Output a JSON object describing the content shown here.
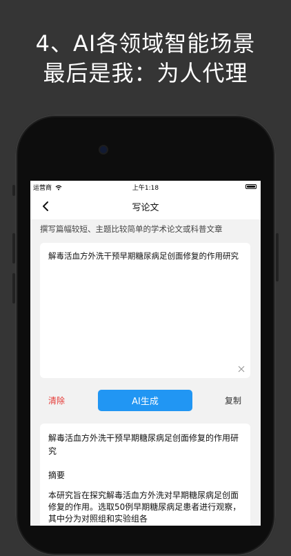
{
  "headline": {
    "line1": "4、AI各领域智能场景",
    "line2": "最后是我：为人代理"
  },
  "status_bar": {
    "carrier": "运营商",
    "time": "上午1:18"
  },
  "nav": {
    "title": "写论文"
  },
  "description": "撰写篇幅较短、主题比较简单的学术论文或科普文章",
  "input": {
    "value": "解毒活血方外洗干预早期糖尿病足创面修复的作用研究"
  },
  "actions": {
    "clear_label": "清除",
    "generate_label": "AI生成",
    "copy_label": "复制"
  },
  "output": {
    "title": "解毒活血方外洗干预早期糖尿病足创面修复的作用研究",
    "heading": "摘要",
    "body": "本研究旨在探究解毒活血方外洗对早期糖尿病足创面修复的作用。选取50例早期糖尿病足患者进行观察，其中分为对照组和实验组各"
  },
  "colors": {
    "accent": "#2196f3",
    "danger": "#e53935",
    "background": "#353535"
  }
}
